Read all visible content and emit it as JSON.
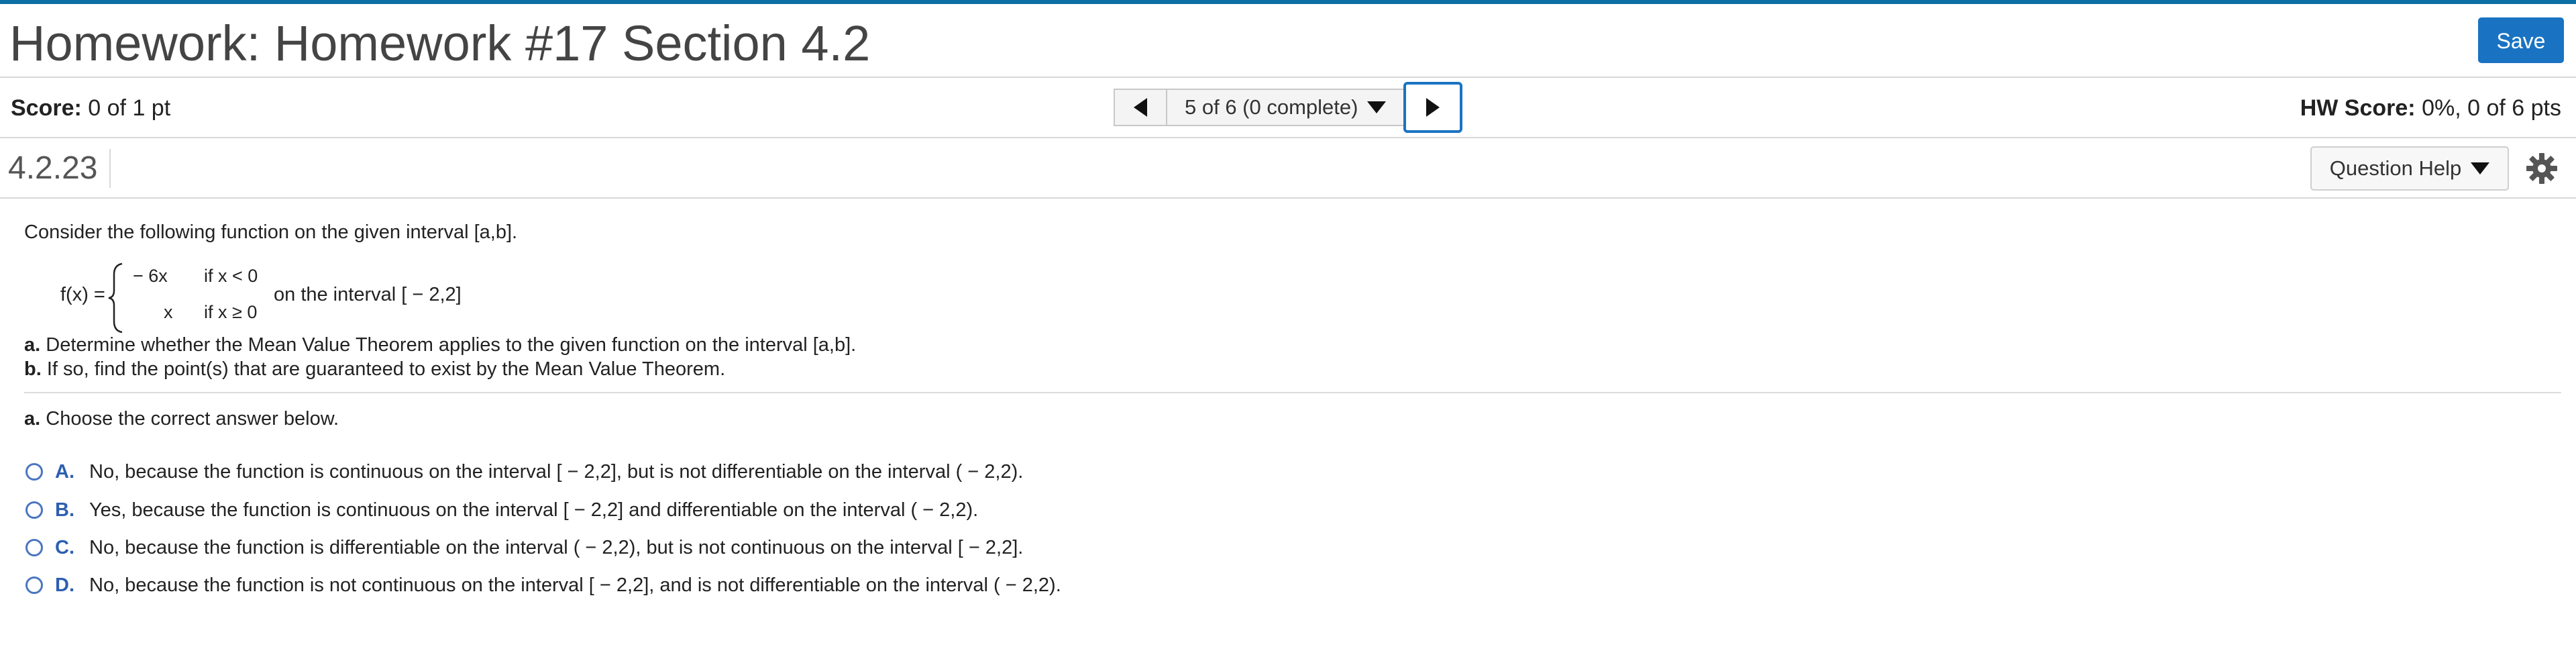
{
  "header": {
    "title": "Homework: Homework #17 Section 4.2",
    "save_label": "Save"
  },
  "scorebar": {
    "score_label": "Score:",
    "score_value": "0 of 1 pt",
    "nav_status": "5 of 6 (0 complete)",
    "hw_score_label": "HW Score:",
    "hw_score_value": "0%, 0 of 6 pts"
  },
  "question_bar": {
    "number": "4.2.23",
    "help_label": "Question Help"
  },
  "question": {
    "intro": "Consider the following function on the given interval [a,b].",
    "fx_label": "f(x) =",
    "piece1_expr": "− 6x",
    "piece1_cond": "if x < 0",
    "piece2_expr": "x",
    "piece2_cond": "if x ≥ 0",
    "interval_text": "on the interval [ − 2,2]",
    "part_a_label": "a.",
    "part_a_text": "Determine whether the Mean Value Theorem applies to the given function on the interval [a,b].",
    "part_b_label": "b.",
    "part_b_text": "If so, find the point(s) that are guaranteed to exist by the Mean Value Theorem."
  },
  "answer": {
    "prompt_label": "a.",
    "prompt_text": "Choose the correct answer below.",
    "options": [
      {
        "letter": "A.",
        "text": "No, because the function is continuous on the interval [ − 2,2], but is not differentiable on the interval ( − 2,2)."
      },
      {
        "letter": "B.",
        "text": "Yes, because the function is continuous on the interval [ − 2,2] and differentiable on the interval ( − 2,2)."
      },
      {
        "letter": "C.",
        "text": "No, because the function is differentiable on the interval ( − 2,2), but is not continuous on the interval [ − 2,2]."
      },
      {
        "letter": "D.",
        "text": "No, because the function is not continuous on the interval [ − 2,2], and is not differentiable on the interval ( − 2,2)."
      }
    ]
  }
}
